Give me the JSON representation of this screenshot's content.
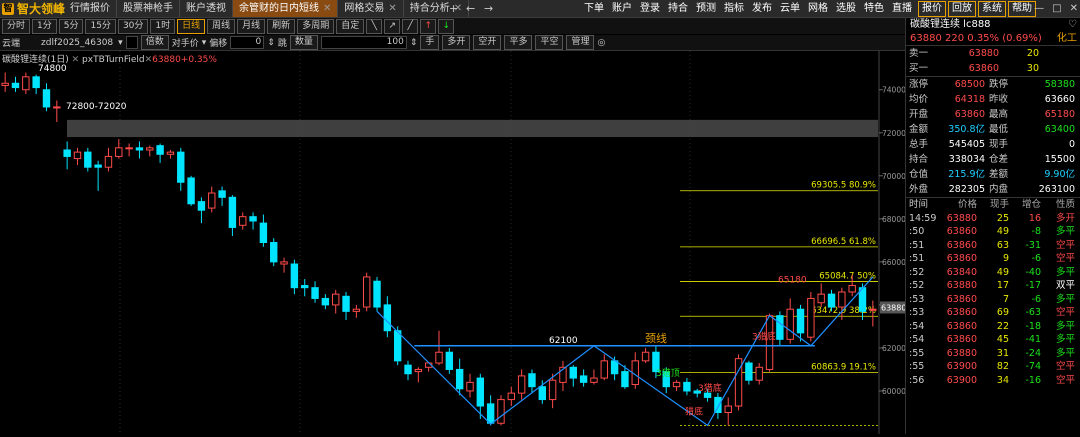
{
  "app": {
    "logo_text": "智大领峰",
    "logo_mark": "智"
  },
  "tabs": [
    {
      "label": "行情报价",
      "active": false
    },
    {
      "label": "股票神枪手",
      "active": false
    },
    {
      "label": "账户透视",
      "active": false
    },
    {
      "label": "余管财的日内短线",
      "active": true
    },
    {
      "label": "网格交易",
      "active": false
    },
    {
      "label": "持合分析",
      "active": false
    }
  ],
  "nav": {
    "plus": "+",
    "back": "←",
    "forward": "→"
  },
  "menus": [
    "下单",
    "账户",
    "登录",
    "持合",
    "预测",
    "指标",
    "发布",
    "云单",
    "网格",
    "选股",
    "特色",
    "直播"
  ],
  "menus_boxed": [
    "报价",
    "回放",
    "系统",
    "帮助"
  ],
  "window": {
    "icon": "♡",
    "min": "—",
    "max": "□",
    "close": "✕"
  },
  "toolbar1": {
    "periods": [
      "分时",
      "1分",
      "5分",
      "15分",
      "30分",
      "1时",
      "日线",
      "周线",
      "月线",
      "刷新",
      "多周期",
      "自定"
    ],
    "selected": "日线"
  },
  "toolbar2": {
    "account": "云端",
    "strategy": "zdlf2025_46308",
    "multiplier_label": "倍数",
    "price_type": "对手价",
    "offset_label": "偏移",
    "offset_value": "0",
    "jump_label": "跳",
    "qty_label": "数量",
    "qty_value": "100",
    "hand": "手",
    "buttons": [
      "多开",
      "空开",
      "平多",
      "平空",
      "管理"
    ]
  },
  "chart": {
    "symbol_title": "碳酸锂连续(1日)",
    "indicator_label": "pxTBTurnField",
    "indicator_value": "63880+0.35%",
    "annotations": {
      "high": "74800",
      "zone": "72800-72020",
      "neckline": "颈线",
      "neck_price": "62100",
      "low1": "58460",
      "low2": "58400",
      "bottom1": "3猎顶",
      "bottom2": "3猎底",
      "bottom3": "猎底",
      "bottom4": "3猎底",
      "peak": "65180"
    },
    "fib_levels": [
      {
        "label": "69305.5 80.9%",
        "price": 69305.5
      },
      {
        "label": "66696.5 61.8%",
        "price": 66696.5
      },
      {
        "label": "65084.7 50%",
        "price": 65084.7
      },
      {
        "label": "63472.9 38.2%",
        "price": 63472.9
      },
      {
        "label": "60863.9 19.1%",
        "price": 60863.9
      }
    ],
    "y_axis_ticks": [
      74000,
      72000,
      70000,
      68000,
      66000,
      64000,
      62000,
      60000
    ],
    "current_price": "63880",
    "colors": {
      "up": "#ff4b4b",
      "down": "#00e5ff",
      "fib": "#e8e800",
      "neck": "#1e90ff"
    }
  },
  "chart_data": {
    "type": "candlestick",
    "ylim": [
      58000,
      75800
    ],
    "candles": [
      [
        74200,
        74300,
        74800,
        73900
      ],
      [
        74300,
        74100,
        74600,
        73900
      ],
      [
        74000,
        74600,
        74800,
        73800
      ],
      [
        74600,
        74100,
        74700,
        73800
      ],
      [
        74000,
        73200,
        74300,
        73000
      ],
      [
        73200,
        73200,
        73500,
        72500
      ],
      [
        71200,
        70900,
        71600,
        70300
      ],
      [
        70800,
        71100,
        71300,
        70500
      ],
      [
        71100,
        70400,
        71300,
        70200
      ],
      [
        70500,
        70400,
        70700,
        69300
      ],
      [
        70400,
        70900,
        71300,
        70200
      ],
      [
        70900,
        71300,
        71700,
        70800
      ],
      [
        71300,
        71300,
        71500,
        70900
      ],
      [
        71300,
        71200,
        71600,
        70800
      ],
      [
        71200,
        71300,
        71400,
        70900
      ],
      [
        71400,
        71000,
        71500,
        70600
      ],
      [
        71000,
        71100,
        71200,
        70800
      ],
      [
        71100,
        69700,
        71300,
        69300
      ],
      [
        69900,
        68700,
        70000,
        68600
      ],
      [
        68800,
        68400,
        69000,
        67800
      ],
      [
        68500,
        69200,
        69500,
        68300
      ],
      [
        69300,
        69000,
        69500,
        68600
      ],
      [
        69000,
        67600,
        69100,
        67200
      ],
      [
        67700,
        68100,
        68300,
        67500
      ],
      [
        68100,
        67900,
        68300,
        67500
      ],
      [
        67800,
        66900,
        68200,
        66700
      ],
      [
        66900,
        66000,
        67100,
        65800
      ],
      [
        65900,
        66000,
        66200,
        65500
      ],
      [
        65900,
        64800,
        66100,
        64500
      ],
      [
        64900,
        64800,
        65200,
        64400
      ],
      [
        64800,
        64300,
        65100,
        64100
      ],
      [
        64300,
        64000,
        64500,
        63800
      ],
      [
        64000,
        64500,
        64700,
        63600
      ],
      [
        64400,
        63700,
        64600,
        63300
      ],
      [
        63700,
        63800,
        64000,
        63400
      ],
      [
        63900,
        65300,
        65500,
        63700
      ],
      [
        65100,
        63900,
        65300,
        63700
      ],
      [
        64000,
        62800,
        64400,
        62500
      ],
      [
        62800,
        61400,
        63000,
        61200
      ],
      [
        61200,
        60800,
        61400,
        60500
      ],
      [
        60900,
        61000,
        61100,
        60400
      ],
      [
        61100,
        61300,
        61300,
        60900
      ],
      [
        61300,
        61800,
        62800,
        61200
      ],
      [
        61800,
        61000,
        62000,
        60800
      ],
      [
        61000,
        60100,
        61500,
        59800
      ],
      [
        60000,
        60400,
        60800,
        59700
      ],
      [
        60600,
        59300,
        60800,
        58700
      ],
      [
        59400,
        58500,
        59800,
        58400
      ],
      [
        58500,
        59600,
        59800,
        58400
      ],
      [
        59600,
        59900,
        60200,
        59300
      ],
      [
        59900,
        60700,
        61000,
        59600
      ],
      [
        60800,
        60200,
        61000,
        59900
      ],
      [
        60200,
        59600,
        60500,
        59400
      ],
      [
        59600,
        60500,
        60800,
        59200
      ],
      [
        60400,
        61100,
        61400,
        60000
      ],
      [
        61100,
        60600,
        61200,
        60200
      ],
      [
        60700,
        60400,
        61000,
        60200
      ],
      [
        60400,
        60600,
        61000,
        60300
      ],
      [
        60600,
        61400,
        61700,
        60500
      ],
      [
        61400,
        60800,
        61600,
        60500
      ],
      [
        60900,
        60200,
        61200,
        60100
      ],
      [
        60300,
        61400,
        61800,
        60100
      ],
      [
        61400,
        61800,
        62000,
        61300
      ],
      [
        61800,
        60900,
        62100,
        60600
      ],
      [
        60900,
        60200,
        61100,
        59900
      ],
      [
        60200,
        60400,
        60500,
        60000
      ],
      [
        60400,
        60000,
        60600,
        59800
      ],
      [
        60000,
        59900,
        60100,
        59700
      ],
      [
        59900,
        59700,
        60100,
        59500
      ],
      [
        59700,
        59000,
        59900,
        58700
      ],
      [
        59000,
        59300,
        59700,
        58400
      ],
      [
        59300,
        61500,
        61700,
        59100
      ],
      [
        61300,
        60500,
        61400,
        60300
      ],
      [
        60500,
        61100,
        61300,
        60300
      ],
      [
        61000,
        63500,
        63600,
        60900
      ],
      [
        63500,
        62400,
        63700,
        62100
      ],
      [
        62400,
        63800,
        64300,
        62200
      ],
      [
        63800,
        62700,
        64000,
        62300
      ],
      [
        62500,
        64300,
        64600,
        62300
      ],
      [
        64100,
        64500,
        65000,
        63900
      ],
      [
        64500,
        63900,
        64700,
        63700
      ],
      [
        63900,
        64600,
        64800,
        63300
      ],
      [
        64600,
        64900,
        65400,
        64400
      ],
      [
        64800,
        63700,
        65000,
        63300
      ],
      [
        63800,
        63800,
        64200,
        63000
      ]
    ]
  },
  "right_panel": {
    "title": "碳酸锂连续 lc888",
    "heart": "♡",
    "quote": {
      "price": "63880",
      "change": "220",
      "pct": "0.35%",
      "pct2": "(0.69%)",
      "sector": "化工"
    },
    "orderbook": [
      {
        "label": "卖一",
        "price": "63880",
        "vol": "20"
      },
      {
        "label": "买一",
        "price": "63860",
        "vol": "30"
      }
    ],
    "stats": [
      {
        "l1": "涨停",
        "v1": "68500",
        "l2": "跌停",
        "v2": "58380",
        "c1": "red",
        "c2": "green"
      },
      {
        "l1": "均价",
        "v1": "64318",
        "l2": "昨收",
        "v2": "63660",
        "c1": "red",
        "c2": "white"
      },
      {
        "l1": "开盘",
        "v1": "63860",
        "l2": "最高",
        "v2": "65180",
        "c1": "red",
        "c2": "red"
      },
      {
        "l1": "金额",
        "v1": "350.8亿",
        "l2": "最低",
        "v2": "63400",
        "c1": "cyan",
        "c2": "green"
      },
      {
        "l1": "总手",
        "v1": "545405",
        "l2": "现手",
        "v2": "0",
        "c1": "white",
        "c2": "white"
      },
      {
        "l1": "持合",
        "v1": "338034",
        "l2": "仓差",
        "v2": "15500",
        "c1": "white",
        "c2": "white"
      },
      {
        "l1": "仓值",
        "v1": "215.9亿",
        "l2": "差额",
        "v2": "9.90亿",
        "c1": "cyan",
        "c2": "cyan"
      },
      {
        "l1": "外盘",
        "v1": "282305",
        "l2": "内盘",
        "v2": "263100",
        "c1": "white",
        "c2": "white"
      }
    ],
    "tick_headers": [
      "时间",
      "价格",
      "现手",
      "增仓",
      "性质"
    ],
    "ticks": [
      {
        "t": "14:59",
        "p": "63880",
        "v": "25",
        "d": "16",
        "n": "多开",
        "pc": "red",
        "dc": "red",
        "nc": "red"
      },
      {
        "t": ":50",
        "p": "63860",
        "v": "49",
        "d": "-8",
        "n": "多平",
        "pc": "red",
        "dc": "green",
        "nc": "green"
      },
      {
        "t": ":51",
        "p": "63860",
        "v": "63",
        "d": "-31",
        "n": "空平",
        "pc": "red",
        "dc": "green",
        "nc": "red"
      },
      {
        "t": ":51",
        "p": "63860",
        "v": "9",
        "d": "-6",
        "n": "空平",
        "pc": "red",
        "dc": "green",
        "nc": "red"
      },
      {
        "t": ":52",
        "p": "63840",
        "v": "49",
        "d": "-40",
        "n": "多平",
        "pc": "red",
        "dc": "green",
        "nc": "green"
      },
      {
        "t": ":52",
        "p": "63880",
        "v": "17",
        "d": "-17",
        "n": "双平",
        "pc": "red",
        "dc": "green",
        "nc": "white"
      },
      {
        "t": ":53",
        "p": "63860",
        "v": "7",
        "d": "-6",
        "n": "多平",
        "pc": "red",
        "dc": "green",
        "nc": "green"
      },
      {
        "t": ":53",
        "p": "63860",
        "v": "69",
        "d": "-63",
        "n": "空平",
        "pc": "red",
        "dc": "green",
        "nc": "red"
      },
      {
        "t": ":54",
        "p": "63860",
        "v": "22",
        "d": "-18",
        "n": "多平",
        "pc": "red",
        "dc": "green",
        "nc": "green"
      },
      {
        "t": ":54",
        "p": "63860",
        "v": "45",
        "d": "-41",
        "n": "多平",
        "pc": "red",
        "dc": "green",
        "nc": "green"
      },
      {
        "t": ":55",
        "p": "63880",
        "v": "31",
        "d": "-24",
        "n": "多平",
        "pc": "red",
        "dc": "green",
        "nc": "green"
      },
      {
        "t": ":55",
        "p": "63900",
        "v": "82",
        "d": "-74",
        "n": "空平",
        "pc": "red",
        "dc": "green",
        "nc": "red"
      },
      {
        "t": ":56",
        "p": "63900",
        "v": "34",
        "d": "-16",
        "n": "空平",
        "pc": "red",
        "dc": "green",
        "nc": "red"
      }
    ]
  }
}
